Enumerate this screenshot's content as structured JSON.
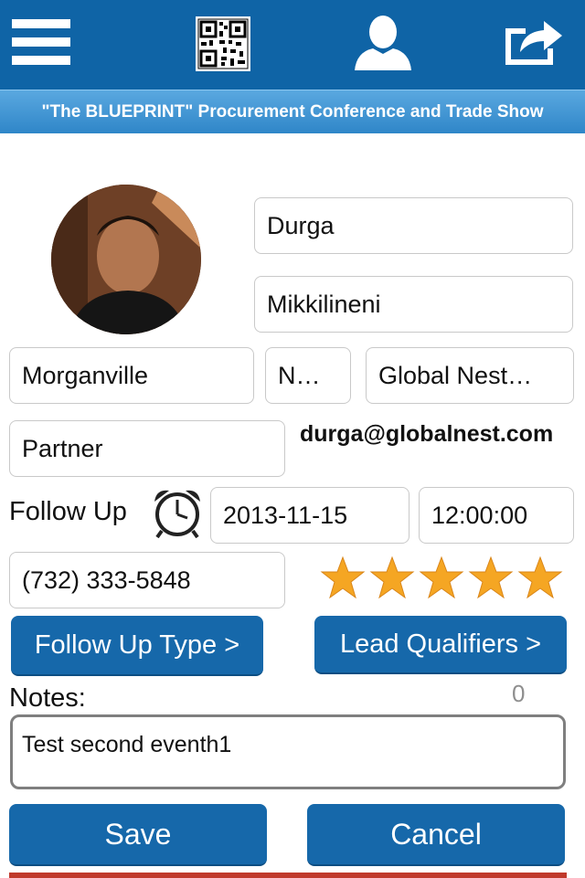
{
  "banner": {
    "title": "\"The BLUEPRINT\" Procurement Conference and Trade Show"
  },
  "toolbar": {
    "menu_icon": "hamburger-menu-icon",
    "qr_icon": "qr-code-icon",
    "profile_icon": "user-profile-icon",
    "share_icon": "share-icon"
  },
  "contact": {
    "first_name": "Durga",
    "last_name": "Mikkilineni",
    "city": "Morganville",
    "state": "N…",
    "company": "Global Nest…",
    "title": "Partner",
    "email": "durga@globalnest.com",
    "phone": "(732) 333-5848"
  },
  "follow_up": {
    "label": "Follow Up",
    "date": "2013-11-15",
    "time": "12:00:00",
    "alarm_icon": "alarm-clock-icon"
  },
  "rating": {
    "value": 5,
    "max": 5,
    "color": "#f5a623"
  },
  "buttons": {
    "follow_up_type": "Follow Up Type >",
    "lead_qualifiers": "Lead Qualifiers >",
    "save": "Save",
    "cancel": "Cancel"
  },
  "notes": {
    "label": "Notes:",
    "value": "Test second eventh1",
    "count": "0"
  },
  "colors": {
    "primary": "#0f64a6",
    "button": "#1668aa",
    "banner": "#3a8fd0"
  }
}
